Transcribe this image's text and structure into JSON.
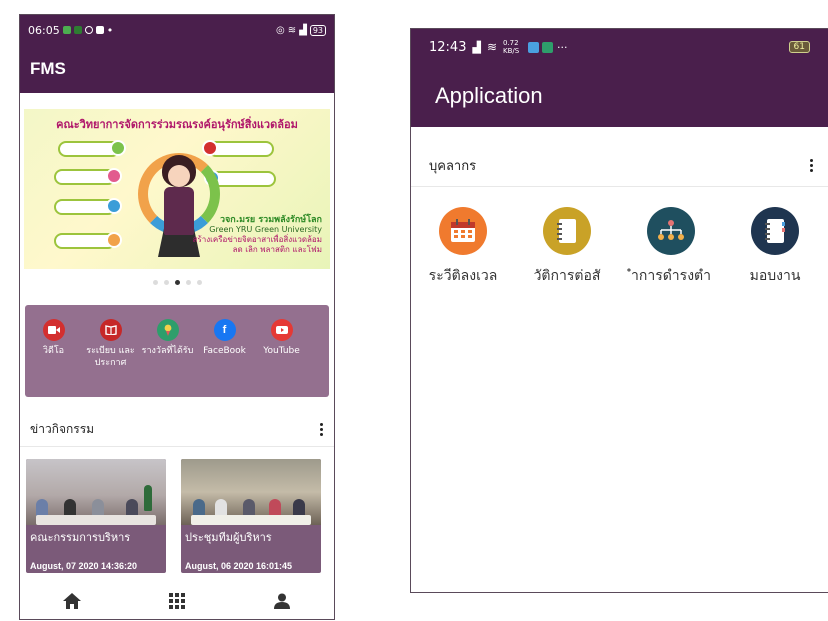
{
  "left_phone": {
    "status_bar": {
      "time": "06:05",
      "battery": "93"
    },
    "app_title": "FMS",
    "banner": {
      "title": "คณะวิทยาการจัดการร่วมรณรงค์อนุรักษ์สิ่งแวดล้อม",
      "subtitle_1": "วจก.มรย รวมพลังรักษ์โลก",
      "subtitle_2": "Green YRU Green University",
      "subtitle_3": "สร้างเครือข่ายจิตอาสาเพื่อสิ่งแวดล้อม",
      "subtitle_4": "ลด เลิก พลาสติก และโฟม"
    },
    "carousel": {
      "total": 5,
      "active": 2
    },
    "menu": [
      {
        "label": "วิดีโอ",
        "icon": "video-icon",
        "color": "#d32f2f"
      },
      {
        "label": "ระเบียบ และ ประกาศ",
        "icon": "book-icon",
        "color": "#c62828"
      },
      {
        "label": "รางวัลที่ได้รับ",
        "icon": "award-icon",
        "color": "#2e9e6b"
      },
      {
        "label": "FaceBook",
        "icon": "facebook-icon",
        "color": "#1877f2"
      },
      {
        "label": "YouTube",
        "icon": "youtube-icon",
        "color": "#e53935"
      }
    ],
    "news_section_title": "ข่าวกิจกรรม",
    "news": [
      {
        "title": "คณะกรรมการบริหาร",
        "date": "August, 07 2020 14:36:20"
      },
      {
        "title": "ประชุมทีมผู้บริหาร",
        "date": "August, 06 2020 16:01:45"
      }
    ],
    "bottom_nav": [
      {
        "icon": "home-icon"
      },
      {
        "icon": "apps-grid-icon"
      },
      {
        "icon": "profile-icon"
      }
    ]
  },
  "right_phone": {
    "status_bar": {
      "time": "12:43",
      "network": "0.72 KB/S",
      "battery": "61"
    },
    "app_title": "Application",
    "section_title": "บุคลากร",
    "apps": [
      {
        "label": "ระวีติลงเวล",
        "icon": "calendar-icon",
        "color": "#f07a2e"
      },
      {
        "label": "วัติการต่อสั",
        "icon": "notebook-icon",
        "color": "#c9a227"
      },
      {
        "label": "ำการดำรงตำ",
        "icon": "org-chart-icon",
        "color": "#1f4f5f"
      },
      {
        "label": "มอบงาน",
        "icon": "task-book-icon",
        "color": "#1f3550"
      }
    ]
  }
}
